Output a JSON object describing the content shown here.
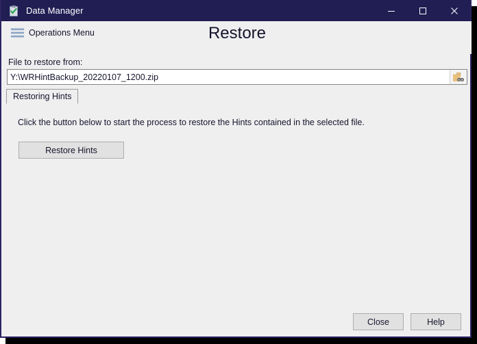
{
  "window": {
    "title": "Data Manager",
    "icon": "clipboard-check-icon",
    "frame_color": "#2b2560",
    "titlebar_color": "#211e54",
    "background_color": "#efeff0",
    "controls": {
      "minimize": "minimize-icon",
      "maximize": "maximize-icon",
      "close": "close-icon"
    }
  },
  "header": {
    "menu_label": "Operations Menu",
    "menu_icon": "hamburger-menu-icon",
    "page_title": "Restore"
  },
  "file_field": {
    "label": "File to restore from:",
    "value": "Y:\\WRHintBackup_20220107_1200.zip",
    "placeholder": "",
    "browse_icon": "folder-browse-icon"
  },
  "tabs": [
    {
      "label": "Restoring Hints",
      "selected": true
    }
  ],
  "tab_content": {
    "instruction": "Click the button below to start the process to restore the Hints contained in the selected file.",
    "action_button": "Restore Hints"
  },
  "footer": {
    "close_label": "Close",
    "help_label": "Help"
  }
}
